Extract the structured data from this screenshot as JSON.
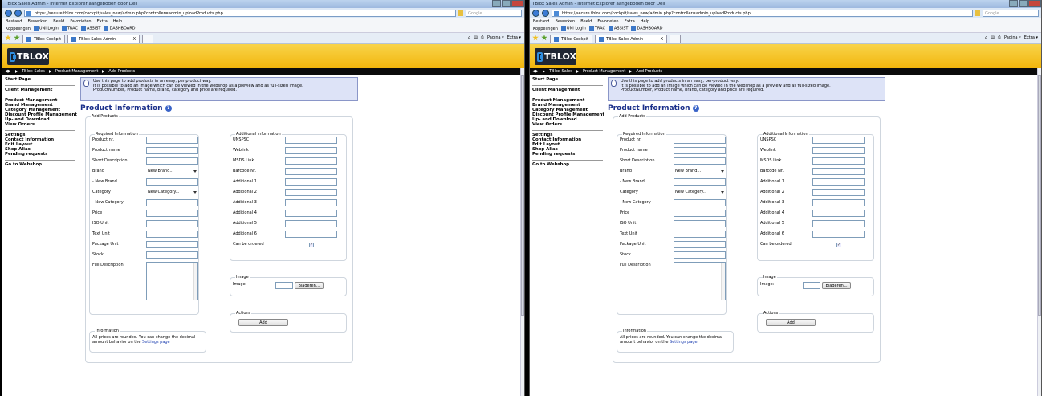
{
  "window_title": "TBlox Sales Admin - Internet Explorer aangeboden door Dell",
  "url": "https://secure.tblox.com/cockpit/sales_new/admin.php?controller=admin_uploadProducts.php",
  "search_placeholder": "Google",
  "menu": [
    "Bestand",
    "Bewerken",
    "Beeld",
    "Favorieten",
    "Extra",
    "Help"
  ],
  "links": [
    "Koppelingen",
    "UNI Login",
    "TRAC",
    "ASSIST",
    "DASHBOARD"
  ],
  "tabs": [
    "TBlox Cockpit",
    "TBlox Sales Admin"
  ],
  "tab_close": "X",
  "tools": [
    "Pagina ▾",
    "Extra ▾"
  ],
  "logo_text": "TBLOX",
  "breadcrumb": [
    "TBlox-Sales",
    "Product Management",
    "Add Products"
  ],
  "sidebar": {
    "group1": [
      "Start Page"
    ],
    "group2": [
      "Client Management"
    ],
    "group3": [
      "Product Management",
      "Brand Management",
      "Category Management",
      "Discount Profile Management",
      "Up- and Download",
      "View Orders"
    ],
    "group4": [
      "Settings",
      "Contact Information",
      "Edit Layout",
      "Shop Alias",
      "Pending requests"
    ],
    "group5": [
      "Go to Webshop"
    ]
  },
  "info_lines": [
    "Use this page to add products in an easy, per-product way.",
    "It is possible to add an image which can be viewed in the webshop as a preview and as full-sized image.",
    "ProductNumber, Product name, brand, category and price are required."
  ],
  "page_title": "Product Information",
  "add_products_legend": "Add Products",
  "required": {
    "legend": "Required Information",
    "fields": [
      "Product nr.",
      "Product name",
      "Short Description",
      "Brand",
      "- New Brand",
      "Category",
      "- New Category",
      "Price",
      "ISO Unit",
      "Text Unit",
      "Package Unit",
      "Stock",
      "Full Description"
    ],
    "brand_select": "New Brand...",
    "category_select": "New Category..."
  },
  "additional": {
    "legend": "Additional Information",
    "fields": [
      "UNSPSC",
      "Weblink",
      "MSDS Link",
      "Barcode Nr.",
      "Additional 1",
      "Additional 2",
      "Additional 3",
      "Additional 4",
      "Additional 5",
      "Additional 6",
      "Can be ordered"
    ],
    "checkbox_mark": "✓"
  },
  "image": {
    "legend": "Image",
    "label": "Image:",
    "browse": "Bladeren..."
  },
  "actions": {
    "legend": "Actions",
    "add": "Add"
  },
  "information": {
    "legend": "Information",
    "text1": "All prices are rounded. You can change the decimal",
    "text2": "amount behavior on the",
    "link": "Settings page"
  }
}
